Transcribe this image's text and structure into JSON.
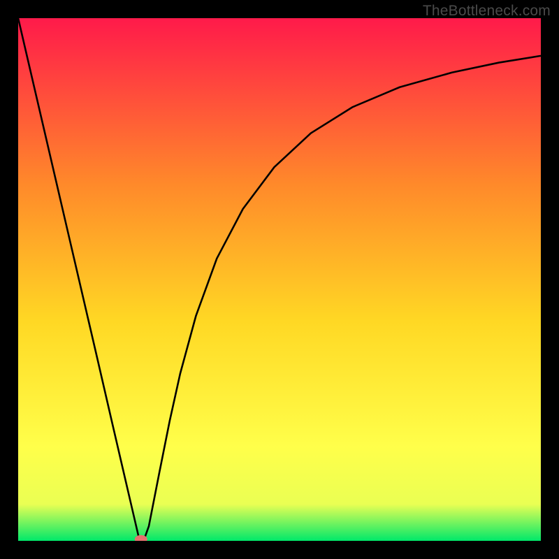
{
  "watermark": "TheBottleneck.com",
  "chart_data": {
    "type": "line",
    "title": "",
    "xlabel": "",
    "ylabel": "",
    "xlim": [
      0,
      100
    ],
    "ylim": [
      0,
      100
    ],
    "grid": false,
    "legend": false,
    "background_gradient": {
      "top": "#ff1a4a",
      "mid_upper": "#ff8a2a",
      "mid": "#ffd824",
      "mid_lower": "#ffff4a",
      "bottom": "#00e86a"
    },
    "series": [
      {
        "name": "bottleneck-curve",
        "x": [
          0,
          5,
          10,
          15,
          18,
          20,
          22,
          23,
          24,
          25,
          27,
          29,
          31,
          34,
          38,
          43,
          49,
          56,
          64,
          73,
          83,
          92,
          100
        ],
        "y": [
          100,
          78.5,
          57,
          35.5,
          22.5,
          13.9,
          5.3,
          1,
          0,
          2.8,
          13,
          23,
          32,
          43,
          54,
          63.5,
          71.5,
          78,
          83,
          86.8,
          89.6,
          91.5,
          92.8
        ]
      }
    ],
    "marker": {
      "name": "optimal-point",
      "x": 23.5,
      "y": 0.3,
      "color": "#e4716e",
      "rx": 9,
      "ry": 6
    }
  }
}
